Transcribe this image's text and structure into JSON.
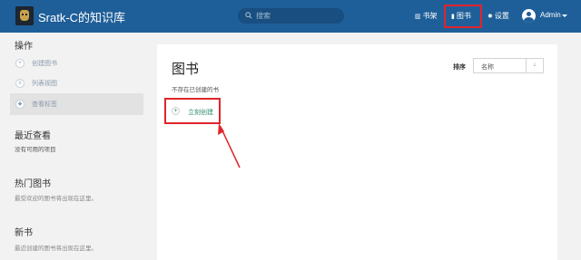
{
  "header": {
    "app_title": "Sratk-C的知识库",
    "search_placeholder": "搜索",
    "nav": {
      "books": "书架",
      "library": "图书",
      "settings": "设置"
    },
    "user": "Admin",
    "logo_icon": "avatar-mask-icon",
    "colors": {
      "bar": "#1f5f99",
      "highlight": "#e0242b"
    }
  },
  "sidebar": {
    "operations_title": "操作",
    "items": [
      {
        "label": "创建图书",
        "icon": "plus-icon",
        "glyph": "+"
      },
      {
        "label": "列表视图",
        "icon": "list-icon",
        "glyph": "≡"
      },
      {
        "label": "查看标签",
        "icon": "tag-icon",
        "glyph": "◆"
      }
    ],
    "recent": {
      "title": "最近查看",
      "text": "没有可用的项目"
    },
    "popular": {
      "title": "热门图书",
      "text": "最受欢迎的图书将出现在这里。"
    },
    "new_books": {
      "title": "新书",
      "text": "最近创建的图书将出现在这里。"
    }
  },
  "main": {
    "title": "图书",
    "sort_label": "排序",
    "sort_value": "名称",
    "sort_direction": "↓",
    "empty_message": "不存在已创建的书",
    "create_label": "立刻创建",
    "create_glyph": "+"
  }
}
